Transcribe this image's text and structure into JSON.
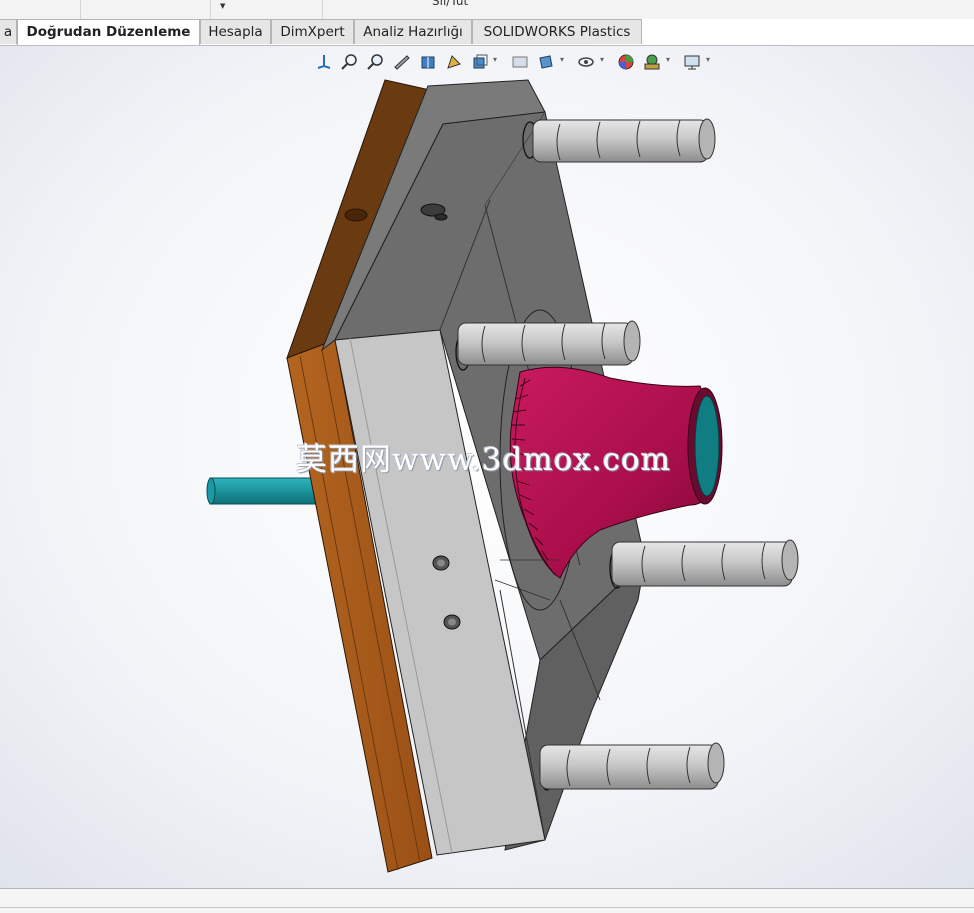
{
  "ribbon": {
    "partial_label": "Sil/Tut"
  },
  "tabs": [
    {
      "label": "a",
      "active": false
    },
    {
      "label": "Doğrudan Düzenleme",
      "active": true
    },
    {
      "label": "Hesapla",
      "active": false
    },
    {
      "label": "DimXpert",
      "active": false
    },
    {
      "label": "Analiz Hazırlığı",
      "active": false
    },
    {
      "label": "SOLIDWORKS Plastics",
      "active": false
    }
  ],
  "view_toolbar": {
    "icons": [
      "view-orientation-icon",
      "zoom-to-fit-icon",
      "zoom-to-area-icon",
      "previous-view-icon",
      "section-view-icon",
      "dynamic-annotation-icon",
      "view-orientation-dropdown-icon",
      "display-style-icon",
      "hide-show-items-icon",
      "edit-appearance-icon",
      "apply-scene-icon",
      "view-settings-icon"
    ]
  },
  "watermark": {
    "text": "莫西网www.3dmox.com"
  },
  "colors": {
    "plate_dark": "#6e6e6e",
    "plate_light": "#c3c3c3",
    "clamp_plate": "#a85a1c",
    "part": "#b0104e",
    "sprue": "#168f98"
  }
}
